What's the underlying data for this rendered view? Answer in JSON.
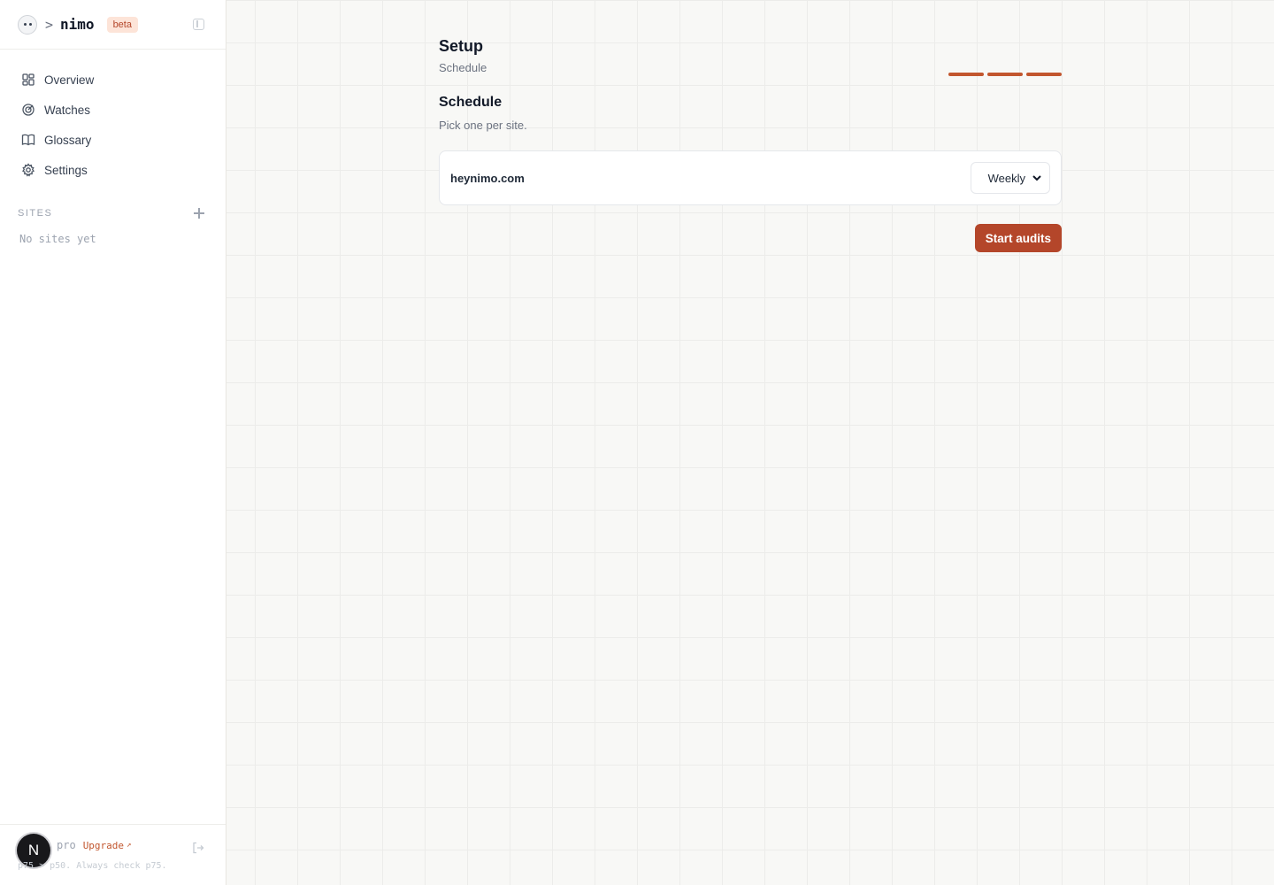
{
  "brand": {
    "prompt": ">",
    "name": "nimo",
    "badge": "beta"
  },
  "nav": {
    "items": [
      {
        "label": "Overview",
        "icon": "grid-icon"
      },
      {
        "label": "Watches",
        "icon": "radar-icon"
      },
      {
        "label": "Glossary",
        "icon": "book-icon"
      },
      {
        "label": "Settings",
        "icon": "gear-icon"
      }
    ]
  },
  "sites": {
    "header": "SITES",
    "empty": "No sites yet"
  },
  "footer": {
    "avatar_initial": "N",
    "plan": "pro",
    "upgrade": "Upgrade",
    "upgrade_arrow": "↗",
    "tip": "p75 > p50. Always check p75."
  },
  "page": {
    "title": "Setup",
    "subtitle": "Schedule",
    "steps_total": 3,
    "steps_active": 3
  },
  "schedule": {
    "title": "Schedule",
    "description": "Pick one per site.",
    "sites": [
      {
        "domain": "heynimo.com",
        "frequency": "Weekly"
      }
    ]
  },
  "actions": {
    "start": "Start audits"
  },
  "colors": {
    "accent": "#b4462a",
    "step": "#c2562e",
    "badge_bg": "#fde4d8"
  }
}
